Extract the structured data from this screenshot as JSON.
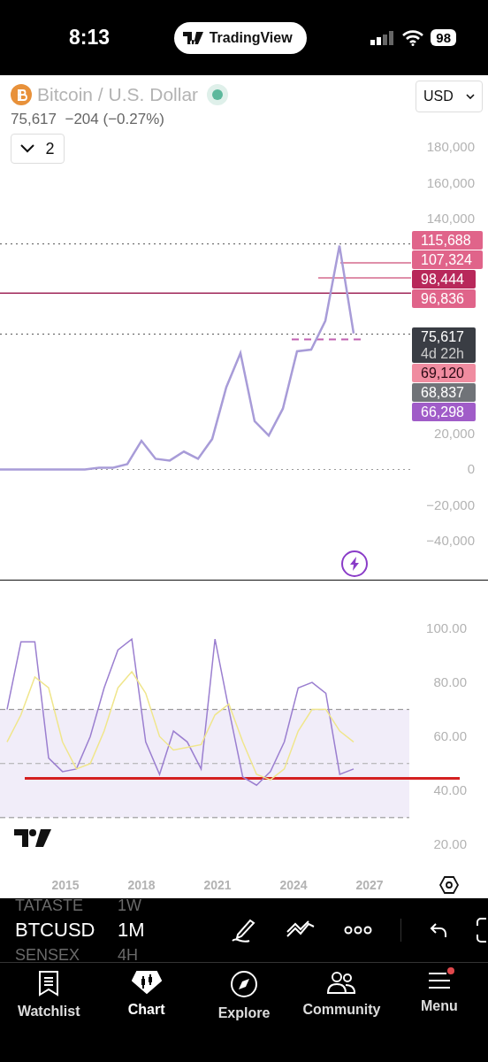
{
  "status_bar": {
    "time": "8:13",
    "app_pill": "TradingView",
    "battery": "98"
  },
  "header": {
    "title": "Bitcoin / U.S. Dollar",
    "live": true,
    "price": "75,617",
    "change": "−204 (−0.27%)",
    "collapse_count": "2",
    "currency": "USD"
  },
  "price_chart": {
    "chart_data": {
      "type": "line",
      "ylim": [
        -40000,
        180000
      ],
      "series": [
        {
          "color": "#a89cd8",
          "values": [
            0,
            0,
            0,
            0,
            0,
            0,
            0,
            1000,
            1000,
            3000,
            16000,
            6000,
            5000,
            10000,
            6000,
            17000,
            46000,
            65000,
            27000,
            19000,
            34000,
            66000,
            67000,
            83000,
            125000,
            76000
          ]
        }
      ],
      "ref_lines": [
        {
          "axis": "y",
          "value": 126000,
          "color": "#555555"
        },
        {
          "axis": "y",
          "value": 98444,
          "color": "#a0285a"
        },
        {
          "axis": "y",
          "value": 75617,
          "color": "#555555"
        },
        {
          "axis": "y",
          "value": 72700,
          "color": "#c060b0"
        },
        {
          "axis": "y",
          "value": 0,
          "color": "#999999"
        }
      ],
      "yticks": [
        {
          "value": 180000,
          "label": "180,000"
        },
        {
          "value": 160000,
          "label": "160,000"
        },
        {
          "value": 140000,
          "label": "140,000"
        },
        {
          "value": 20000,
          "label": "20,000"
        },
        {
          "value": 0,
          "label": "0"
        },
        {
          "value": -20000,
          "label": "−20,000"
        },
        {
          "value": -40000,
          "label": "−40,000"
        }
      ]
    },
    "price_tags": [
      {
        "kind": "level",
        "text": "115,688",
        "color": "#e0648a"
      },
      {
        "kind": "level",
        "text": "107,324",
        "color": "#e0648a"
      },
      {
        "kind": "level",
        "text": "98,444",
        "color": "#b8285a"
      },
      {
        "kind": "level",
        "text": "96,836",
        "color": "#e0648a"
      },
      {
        "kind": "current",
        "text": "75,617",
        "countdown": "4d 22h",
        "color": "#3a3d44"
      },
      {
        "kind": "light",
        "text": "69,120",
        "color": "#f08ca0"
      },
      {
        "kind": "level",
        "text": "68,837",
        "color": "#707378"
      },
      {
        "kind": "level",
        "text": "66,298",
        "color": "#a05cc8"
      }
    ]
  },
  "rsi_chart": {
    "chart_data": {
      "type": "line",
      "ylim": [
        20,
        100
      ],
      "bands": [
        {
          "axis": "y",
          "from": 30,
          "to": 70,
          "color": "#f1edf9"
        }
      ],
      "ref_lines": [
        {
          "axis": "y",
          "value": 70,
          "color": "#888888"
        },
        {
          "axis": "y",
          "value": 50,
          "color": "#aaaaaa"
        },
        {
          "axis": "y",
          "value": 30,
          "color": "#888888"
        },
        {
          "axis": "y",
          "value": 44.5,
          "color": "#d42020"
        }
      ],
      "series": [
        {
          "color": "#9b7fd0",
          "values": [
            70,
            95,
            95,
            52,
            47,
            48,
            60,
            78,
            92,
            96,
            58,
            46,
            62,
            58,
            48,
            96,
            70,
            45,
            42,
            47,
            58,
            78,
            80,
            76,
            46,
            48
          ]
        },
        {
          "color": "#f0e68c",
          "values": [
            58,
            68,
            82,
            78,
            58,
            48,
            50,
            62,
            78,
            84,
            76,
            60,
            55,
            56,
            57,
            68,
            72,
            58,
            46,
            44,
            48,
            62,
            70,
            70,
            62,
            58
          ]
        }
      ],
      "yticks": [
        {
          "value": 100,
          "label": "100.00"
        },
        {
          "value": 80,
          "label": "80.00"
        },
        {
          "value": 60,
          "label": "60.00"
        },
        {
          "value": 40,
          "label": "40.00"
        },
        {
          "value": 20,
          "label": "20.00"
        }
      ]
    }
  },
  "time_axis": [
    "2015",
    "2018",
    "2021",
    "2024",
    "2027"
  ],
  "toolbar": {
    "symbols": [
      {
        "symbol": "TATASTE",
        "interval": "1W",
        "selected": false
      },
      {
        "symbol": "BTCUSD",
        "interval": "1M",
        "selected": true
      },
      {
        "symbol": "SENSEX",
        "interval": "4H",
        "selected": false
      }
    ]
  },
  "tab_bar": [
    {
      "label": "Watchlist",
      "selected": false,
      "badge": false
    },
    {
      "label": "Chart",
      "selected": true,
      "badge": false
    },
    {
      "label": "Explore",
      "selected": false,
      "badge": false
    },
    {
      "label": "Community",
      "selected": false,
      "badge": false
    },
    {
      "label": "Menu",
      "selected": false,
      "badge": true
    }
  ]
}
